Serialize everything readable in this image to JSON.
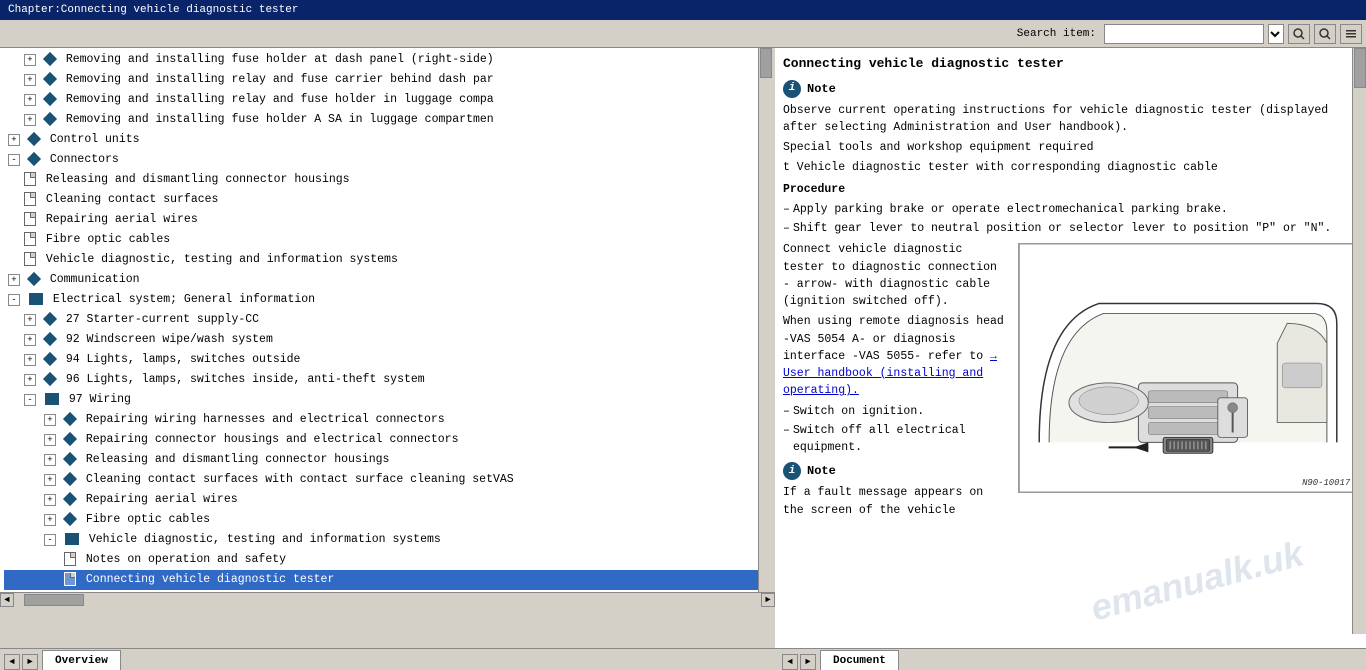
{
  "titleBar": {
    "text": "Chapter:Connecting vehicle diagnostic tester"
  },
  "toolbar": {
    "searchLabel": "Search item:",
    "searchPlaceholder": "",
    "buttons": [
      "search1",
      "search2",
      "options"
    ]
  },
  "leftPanel": {
    "items": [
      {
        "id": 1,
        "indent": "indent1",
        "type": "folder-expand",
        "text": "Removing and installing fuse holder at dash panel (right-side)"
      },
      {
        "id": 2,
        "indent": "indent1",
        "type": "folder-expand",
        "text": "Removing and installing relay and fuse carrier behind dash par"
      },
      {
        "id": 3,
        "indent": "indent1",
        "type": "folder-expand",
        "text": "Removing and installing relay and fuse holder in luggage compa"
      },
      {
        "id": 4,
        "indent": "indent1",
        "type": "folder-expand",
        "text": "Removing and installing fuse holder A SA in luggage compartmen"
      },
      {
        "id": 5,
        "indent": "indent0",
        "type": "folder-expand",
        "text": "Control units"
      },
      {
        "id": 6,
        "indent": "indent0",
        "type": "folder-expand",
        "text": "Connectors"
      },
      {
        "id": 7,
        "indent": "indent1",
        "type": "doc",
        "text": "Releasing and dismantling connector housings"
      },
      {
        "id": 8,
        "indent": "indent1",
        "type": "doc",
        "text": "Cleaning contact surfaces"
      },
      {
        "id": 9,
        "indent": "indent1",
        "type": "doc",
        "text": "Repairing aerial wires"
      },
      {
        "id": 10,
        "indent": "indent1",
        "type": "doc",
        "text": "Fibre optic cables"
      },
      {
        "id": 11,
        "indent": "indent1",
        "type": "doc",
        "text": "Vehicle diagnostic, testing and information systems"
      },
      {
        "id": 12,
        "indent": "indent0",
        "type": "folder-expand",
        "text": "Communication"
      },
      {
        "id": 13,
        "indent": "indent0",
        "type": "folder-open",
        "text": "Electrical system; General information"
      },
      {
        "id": 14,
        "indent": "indent1",
        "type": "folder-expand",
        "text": "27 Starter-current supply-CC"
      },
      {
        "id": 15,
        "indent": "indent1",
        "type": "folder-expand",
        "text": "92 Windscreen wipe/wash system"
      },
      {
        "id": 16,
        "indent": "indent1",
        "type": "folder-expand",
        "text": "94 Lights, lamps, switches outside"
      },
      {
        "id": 17,
        "indent": "indent1",
        "type": "folder-expand",
        "text": "96 Lights, lamps, switches inside, anti-theft system"
      },
      {
        "id": 18,
        "indent": "indent1",
        "type": "folder-open",
        "text": "97 Wiring"
      },
      {
        "id": 19,
        "indent": "indent2",
        "type": "folder-expand",
        "text": "Repairing wiring harnesses and electrical connectors"
      },
      {
        "id": 20,
        "indent": "indent2",
        "type": "folder-expand",
        "text": "Repairing connector housings and electrical connectors"
      },
      {
        "id": 21,
        "indent": "indent2",
        "type": "folder-expand",
        "text": "Releasing and dismantling connector housings"
      },
      {
        "id": 22,
        "indent": "indent2",
        "type": "folder-expand",
        "text": "Cleaning contact surfaces with contact surface cleaning setVAS"
      },
      {
        "id": 23,
        "indent": "indent2",
        "type": "folder-expand",
        "text": "Repairing aerial wires"
      },
      {
        "id": 24,
        "indent": "indent2",
        "type": "folder-expand",
        "text": "Fibre optic cables"
      },
      {
        "id": 25,
        "indent": "indent2",
        "type": "folder-open",
        "text": "Vehicle diagnostic, testing and information systems"
      },
      {
        "id": 26,
        "indent": "indent3",
        "type": "doc",
        "text": "Notes on operation and safety"
      },
      {
        "id": 27,
        "indent": "indent3",
        "type": "doc-selected",
        "text": "Connecting vehicle diagnostic tester"
      }
    ]
  },
  "rightPanel": {
    "title": "Connecting vehicle diagnostic tester",
    "noteLabel": "Note",
    "noteText": "Observe current operating instructions for vehicle diagnostic tester (displayed after selecting Administration and User handbook).",
    "specialTools": "Special tools and workshop equipment required",
    "toolItem": "t  Vehicle diagnostic tester with corresponding diagnostic cable",
    "procedureTitle": "Procedure",
    "steps": [
      "Apply parking brake or operate electromechanical parking brake.",
      "Shift gear lever to neutral position or selector lever to position \"P\" or \"N\"."
    ],
    "connectText": "Connect vehicle diagnostic tester to diagnostic connection - arrow- with diagnostic cable (ignition switched off).",
    "remoteText": "When using remote diagnosis head -VAS 5054 A- or diagnosis interface -VAS 5055- refer to",
    "linkText": "→ User handbook (installing and operating).",
    "step3": "Switch on ignition.",
    "step4": "Switch off all electrical equipment.",
    "note2Label": "Note",
    "note2Text": "If a fault message appears on the screen of the vehicle",
    "diagramLabel": "N90-10017",
    "arrowText": "arrow - With diagnostic"
  },
  "tabs": {
    "left": "Overview",
    "right": "Document"
  },
  "watermark": "emanualk.uk"
}
